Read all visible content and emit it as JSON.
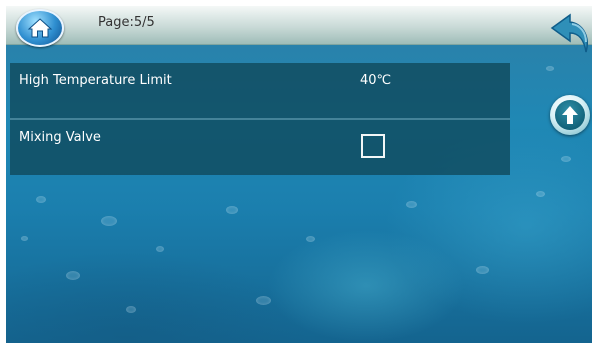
{
  "header": {
    "page_indicator": "Page:5/5",
    "home_icon": "home-icon",
    "back_icon": "return-arrow-icon"
  },
  "settings": [
    {
      "label": "High Temperature Limit",
      "value": "40℃",
      "control": "text"
    },
    {
      "label": "Mixing Valve",
      "checked": false,
      "control": "checkbox"
    }
  ],
  "scroll": {
    "up_icon": "arrow-up-icon"
  },
  "colors": {
    "topbar": "#c9dad7",
    "panel": "#10485a",
    "background": "#1f88b5",
    "text": "#ffffff",
    "home_button": "#2f8fd0",
    "back_arrow": "#2f8fb8"
  }
}
